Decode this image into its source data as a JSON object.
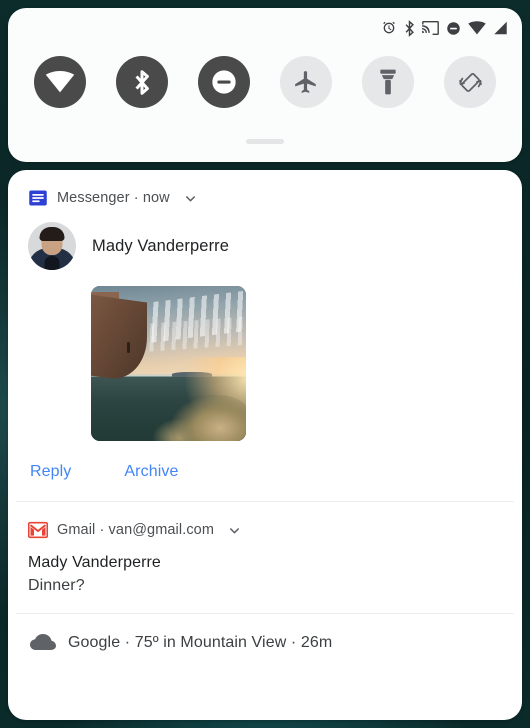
{
  "wallpaper_color": "#0a2424",
  "status_bar": {
    "icons": [
      {
        "name": "alarm-icon",
        "label": "Alarm set"
      },
      {
        "name": "bluetooth-icon",
        "label": "Bluetooth on"
      },
      {
        "name": "cast-icon",
        "label": "Casting"
      },
      {
        "name": "do-not-disturb-icon",
        "label": "Do not disturb"
      },
      {
        "name": "wifi-icon",
        "label": "Wi-Fi full"
      },
      {
        "name": "cellular-signal-icon",
        "label": "Mobile signal"
      }
    ]
  },
  "quick_settings": {
    "tiles": [
      {
        "name": "wifi-tile",
        "label": "Wi-Fi",
        "state": "on"
      },
      {
        "name": "bluetooth-tile",
        "label": "Bluetooth",
        "state": "on"
      },
      {
        "name": "dnd-tile",
        "label": "Do Not Disturb",
        "state": "on"
      },
      {
        "name": "airplane-tile",
        "label": "Airplane mode",
        "state": "off"
      },
      {
        "name": "flashlight-tile",
        "label": "Flashlight",
        "state": "off"
      },
      {
        "name": "auto-rotate-tile",
        "label": "Auto-rotate",
        "state": "off"
      }
    ],
    "drag_handle": "drag-handle"
  },
  "notifications": [
    {
      "app": "Messenger",
      "header": "Messenger · now",
      "time": "now",
      "sender": "Mady Vanderperre",
      "has_image": true,
      "image_alt": "Sunset over cliff and ocean",
      "actions": [
        {
          "label": "Reply",
          "name": "reply-button"
        },
        {
          "label": "Archive",
          "name": "archive-button"
        }
      ]
    },
    {
      "app": "Gmail",
      "header": "Gmail · van@gmail.com",
      "account": "van@gmail.com",
      "title": "Mady Vanderperre",
      "subtitle": "Dinner?"
    },
    {
      "app": "Google",
      "header": "Google · 75º in Mountain View · 26m",
      "temperature": "75º",
      "location": "Mountain View",
      "time": "26m"
    }
  ],
  "colors": {
    "action_blue": "#4285f4",
    "messenger_blue": "#2d41d4",
    "gmail_red": "#ea4335",
    "tile_on": "#4a4a4a",
    "tile_off": "#e6e7e8"
  }
}
